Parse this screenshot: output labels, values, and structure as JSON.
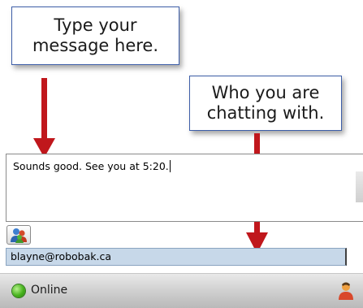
{
  "callouts": {
    "type_message": "Type your\nmessage here.",
    "who_chatting": "Who you are\nchatting with."
  },
  "chat": {
    "input_value": "Sounds good. See you at 5:20."
  },
  "recipient": {
    "address": "blayne@robobak.ca"
  },
  "status": {
    "label": "Online",
    "color": "#46b21c"
  },
  "icons": {
    "contacts_button": "contacts-people-icon",
    "status_indicator": "online-status-icon",
    "presence": "user-presence-icon"
  },
  "colors": {
    "arrow": "#c0171c",
    "callout_border": "#3d5ea8",
    "recipient_bar": "#c7d8e9"
  }
}
